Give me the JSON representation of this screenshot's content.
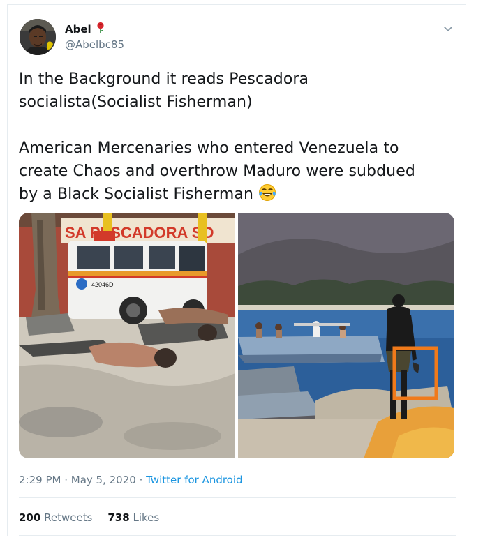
{
  "author": {
    "display_name": "Abel",
    "handle": "@Abelbc85",
    "name_badge_icon": "rose-icon"
  },
  "tweet": {
    "paragraph_1": "In the Background it reads Pescadora\nsocialista(Socialist Fisherman)",
    "paragraph_2": "American Mercenaries who entered Venezuela to\ncreate Chaos and overthrow Maduro were subdued\nby a Black Socialist Fisherman",
    "emoji_icon": "tears-of-joy-emoji-icon"
  },
  "media": {
    "photo_1": {
      "sign_text": "SA PESCADORA SO",
      "vehicle_number": "42046D"
    },
    "photo_2": {
      "highlight_color": "#f07a1a"
    }
  },
  "meta": {
    "time": "2:29 PM",
    "separator_1": " · ",
    "date": "May 5, 2020",
    "separator_2": " · ",
    "source": "Twitter for Android"
  },
  "stats": {
    "retweets_count": "200",
    "retweets_label": "Retweets",
    "likes_count": "738",
    "likes_label": "Likes"
  },
  "colors": {
    "text_primary": "#14171a",
    "text_secondary": "#657786",
    "link": "#1b95e0",
    "divider": "#e6ecf0"
  }
}
